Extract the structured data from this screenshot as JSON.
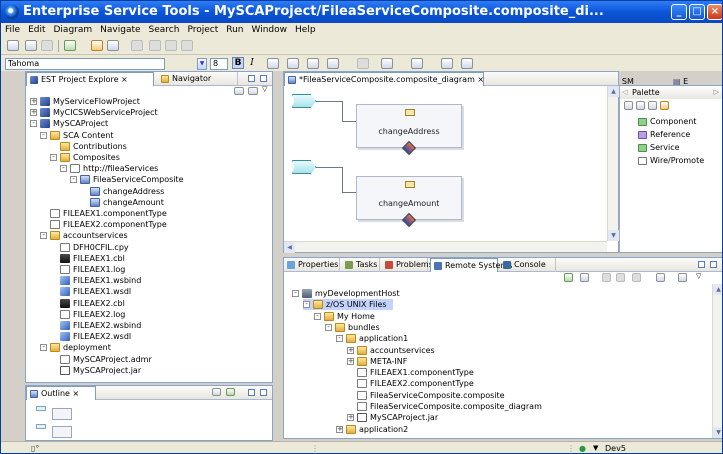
{
  "window": {
    "title": "Enterprise Service Tools - MySCAProject/FileaServiceComposite.composite_di..."
  },
  "menu": [
    "File",
    "Edit",
    "Diagram",
    "Navigate",
    "Search",
    "Project",
    "Run",
    "Window",
    "Help"
  ],
  "toolbar": {
    "font_name": "Tahoma",
    "font_size": "8",
    "bold_label": "B",
    "italic_label": "I",
    "perspective_label": "CICS SM",
    "perspective_extra": "E"
  },
  "project_explorer": {
    "tab_label": "EST Project Explore",
    "navigator_label": "Navigator",
    "items": [
      {
        "label": "MyServiceFlowProject",
        "depth": 0,
        "exp": "+",
        "icon": "proj"
      },
      {
        "label": "MyCICSWebServiceProject",
        "depth": 0,
        "exp": "+",
        "icon": "proj"
      },
      {
        "label": "MySCAProject",
        "depth": 0,
        "exp": "-",
        "icon": "proj"
      },
      {
        "label": "SCA Content",
        "depth": 1,
        "exp": "-",
        "icon": "folder"
      },
      {
        "label": "Contributions",
        "depth": 2,
        "exp": "",
        "icon": "folder"
      },
      {
        "label": "Composites",
        "depth": 2,
        "exp": "-",
        "icon": "folder"
      },
      {
        "label": "http://fileaServices",
        "depth": 3,
        "exp": "-",
        "icon": "file"
      },
      {
        "label": "FileaServiceComposite",
        "depth": 4,
        "exp": "-",
        "icon": "comp"
      },
      {
        "label": "changeAddress",
        "depth": 5,
        "exp": "",
        "icon": "comp"
      },
      {
        "label": "changeAmount",
        "depth": 5,
        "exp": "",
        "icon": "comp"
      },
      {
        "label": "FILEAEX1.componentType",
        "depth": 1,
        "exp": "",
        "icon": "file"
      },
      {
        "label": "FILEAEX2.componentType",
        "depth": 1,
        "exp": "",
        "icon": "file"
      },
      {
        "label": "accountservices",
        "depth": 1,
        "exp": "-",
        "icon": "folder"
      },
      {
        "label": "DFH0CFIL.cpy",
        "depth": 2,
        "exp": "",
        "icon": "file"
      },
      {
        "label": "FILEAEX1.cbl",
        "depth": 2,
        "exp": "",
        "icon": "cbl"
      },
      {
        "label": "FILEAEX1.log",
        "depth": 2,
        "exp": "",
        "icon": "file"
      },
      {
        "label": "FILEAEX1.wsbind",
        "depth": 2,
        "exp": "",
        "icon": "wsdl"
      },
      {
        "label": "FILEAEX1.wsdl",
        "depth": 2,
        "exp": "",
        "icon": "wsdl"
      },
      {
        "label": "FILEAEX2.cbl",
        "depth": 2,
        "exp": "",
        "icon": "cbl"
      },
      {
        "label": "FILEAEX2.log",
        "depth": 2,
        "exp": "",
        "icon": "file"
      },
      {
        "label": "FILEAEX2.wsbind",
        "depth": 2,
        "exp": "",
        "icon": "wsdl"
      },
      {
        "label": "FILEAEX2.wsdl",
        "depth": 2,
        "exp": "",
        "icon": "wsdl"
      },
      {
        "label": "deployment",
        "depth": 1,
        "exp": "-",
        "icon": "folder"
      },
      {
        "label": "MySCAProject.admr",
        "depth": 2,
        "exp": "",
        "icon": "file"
      },
      {
        "label": "MySCAProject.jar",
        "depth": 2,
        "exp": "",
        "icon": "doc"
      }
    ]
  },
  "outline": {
    "tab_label": "Outline"
  },
  "editor": {
    "tab_label": "*FileaServiceComposite.composite_diagram",
    "components": [
      "changeAddress",
      "changeAmount"
    ]
  },
  "palette": {
    "title": "Palette",
    "items": [
      "Component",
      "Reference",
      "Service",
      "Wire/Promote"
    ]
  },
  "bottom_tabs": [
    "Properties",
    "Tasks",
    "Problems",
    "Remote Systems",
    "Console"
  ],
  "remote_tree": [
    {
      "label": "myDevelopmentHost",
      "depth": 0,
      "exp": "-",
      "icon": "host"
    },
    {
      "label": "z/OS UNIX Files",
      "depth": 1,
      "exp": "-",
      "icon": "folder",
      "selected": true
    },
    {
      "label": "My Home",
      "depth": 2,
      "exp": "-",
      "icon": "folder"
    },
    {
      "label": "bundles",
      "depth": 3,
      "exp": "-",
      "icon": "folder"
    },
    {
      "label": "application1",
      "depth": 4,
      "exp": "-",
      "icon": "folder"
    },
    {
      "label": "accountservices",
      "depth": 5,
      "exp": "+",
      "icon": "folder"
    },
    {
      "label": "META-INF",
      "depth": 5,
      "exp": "+",
      "icon": "folder"
    },
    {
      "label": "FILEAEX1.componentType",
      "depth": 5,
      "exp": "",
      "icon": "file"
    },
    {
      "label": "FILEAEX2.componentType",
      "depth": 5,
      "exp": "",
      "icon": "file"
    },
    {
      "label": "FileaServiceComposite.composite",
      "depth": 5,
      "exp": "",
      "icon": "file"
    },
    {
      "label": "FileaServiceComposite.composite_diagram",
      "depth": 5,
      "exp": "",
      "icon": "file"
    },
    {
      "label": "MySCAProject.jar",
      "depth": 5,
      "exp": "+",
      "icon": "doc"
    },
    {
      "label": "application2",
      "depth": 4,
      "exp": "+",
      "icon": "folder"
    }
  ],
  "status": {
    "connection": "Dev5"
  },
  "colors": {
    "titlebar": "#0b56d8",
    "selection": "#c3d3fd"
  }
}
